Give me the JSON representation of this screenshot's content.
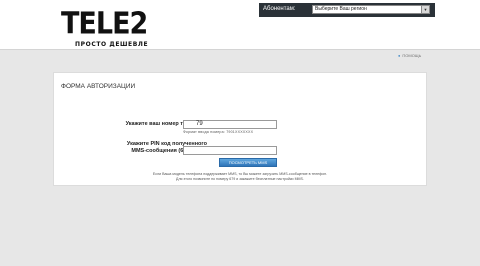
{
  "header": {
    "logo_text": "TELE2",
    "logo_tagline": "ПРОСТО ДЕШЕВЛЕ",
    "region_label": "Абонентам:",
    "region_select_value": "Выберите Ваш регион",
    "help_link": "ПОМОЩЬ"
  },
  "auth_form": {
    "title": "ФОРМА АВТОРИЗАЦИИ",
    "phone_label": "Укажите ваш номер телефона",
    "phone_value": "79",
    "phone_hint": "Формат ввода номера: 7901XXXXXXX",
    "pin_label_line1": "Укажите PIN код полученного",
    "pin_label_line2": "MMS-сообщения (6 знаков):",
    "pin_value": "",
    "submit_label": "ПОСМОТРЕТЬ MMS",
    "note_line1": "Если Ваша модель телефона поддерживает MMS, то Вы можете загрузить MMS-сообщение в телефон.",
    "note_line2": "Для этого позвоните по номеру 679 и закажите бесплатные настройки MMS."
  },
  "colors": {
    "page_background": "#e7e7e7",
    "region_strip": "#2b3238",
    "button": "#3b86cf"
  }
}
